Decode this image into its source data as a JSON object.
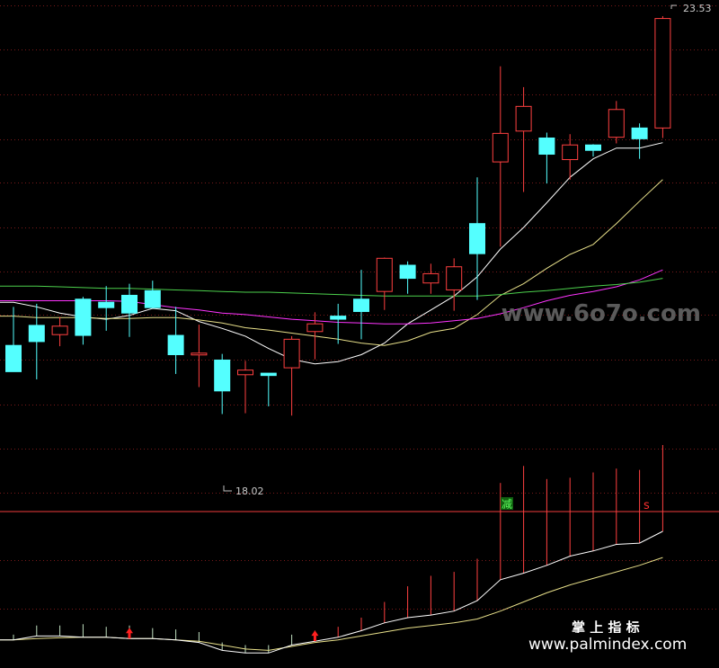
{
  "chart_data": {
    "type": "candlestick",
    "price_labels": {
      "high": "23.53",
      "low": "18.02"
    },
    "price_range": [
      17.7,
      23.6
    ],
    "candles": [
      {
        "o": 19.26,
        "h": 19.76,
        "l": 18.95,
        "c": 18.92
      },
      {
        "o": 19.52,
        "h": 19.8,
        "l": 18.82,
        "c": 19.31
      },
      {
        "o": 19.4,
        "h": 19.63,
        "l": 19.25,
        "c": 19.51
      },
      {
        "o": 19.86,
        "h": 19.89,
        "l": 19.27,
        "c": 19.39
      },
      {
        "o": 19.82,
        "h": 20.03,
        "l": 19.45,
        "c": 19.75
      },
      {
        "o": 19.91,
        "h": 20.06,
        "l": 19.37,
        "c": 19.68
      },
      {
        "o": 19.97,
        "h": 20.1,
        "l": 19.79,
        "c": 19.75
      },
      {
        "o": 19.39,
        "h": 19.76,
        "l": 18.89,
        "c": 19.14
      },
      {
        "o": 19.15,
        "h": 19.53,
        "l": 18.72,
        "c": 19.16
      },
      {
        "o": 19.07,
        "h": 19.15,
        "l": 18.37,
        "c": 18.67
      },
      {
        "o": 18.88,
        "h": 19.06,
        "l": 18.38,
        "c": 18.94
      },
      {
        "o": 18.9,
        "h": 18.9,
        "l": 18.47,
        "c": 18.87
      },
      {
        "o": 18.97,
        "h": 19.38,
        "l": 18.35,
        "c": 19.34
      },
      {
        "o": 19.44,
        "h": 19.69,
        "l": 19.08,
        "c": 19.54
      },
      {
        "o": 19.64,
        "h": 19.8,
        "l": 19.28,
        "c": 19.6
      },
      {
        "o": 19.86,
        "h": 20.24,
        "l": 19.34,
        "c": 19.7
      },
      {
        "o": 19.96,
        "h": 20.4,
        "l": 19.72,
        "c": 20.39
      },
      {
        "o": 20.3,
        "h": 20.35,
        "l": 19.93,
        "c": 20.13
      },
      {
        "o": 20.07,
        "h": 20.32,
        "l": 19.93,
        "c": 20.19
      },
      {
        "o": 19.98,
        "h": 20.39,
        "l": 19.71,
        "c": 20.28
      },
      {
        "o": 20.84,
        "h": 21.44,
        "l": 19.85,
        "c": 20.45
      },
      {
        "o": 21.64,
        "h": 22.88,
        "l": 20.54,
        "c": 22.01
      },
      {
        "o": 22.04,
        "h": 22.61,
        "l": 21.25,
        "c": 22.36
      },
      {
        "o": 21.95,
        "h": 22.02,
        "l": 21.36,
        "c": 21.74
      },
      {
        "o": 21.67,
        "h": 22.0,
        "l": 21.41,
        "c": 21.86
      },
      {
        "o": 21.86,
        "h": 21.87,
        "l": 21.71,
        "c": 21.79
      },
      {
        "o": 21.96,
        "h": 22.43,
        "l": 21.88,
        "c": 22.32
      },
      {
        "o": 22.08,
        "h": 22.14,
        "l": 21.68,
        "c": 21.94
      },
      {
        "o": 22.08,
        "h": 23.53,
        "l": 21.95,
        "c": 23.5
      }
    ],
    "ma_lines": [
      {
        "color": "#ffffff",
        "values": [
          19.82,
          19.76,
          19.68,
          19.63,
          19.6,
          19.65,
          19.74,
          19.71,
          19.57,
          19.48,
          19.38,
          19.22,
          19.08,
          19.02,
          19.05,
          19.14,
          19.29,
          19.54,
          19.72,
          19.9,
          20.15,
          20.51,
          20.79,
          21.11,
          21.44,
          21.68,
          21.82,
          21.82,
          21.89
        ]
      },
      {
        "color": "#e8e08a",
        "values": [
          19.64,
          19.62,
          19.62,
          19.62,
          19.61,
          19.61,
          19.62,
          19.62,
          19.59,
          19.55,
          19.49,
          19.46,
          19.42,
          19.38,
          19.34,
          19.29,
          19.26,
          19.32,
          19.43,
          19.48,
          19.66,
          19.91,
          20.06,
          20.26,
          20.44,
          20.57,
          20.84,
          21.13,
          21.41
        ]
      },
      {
        "color": "#ff34ff",
        "values": [
          19.84,
          19.84,
          19.84,
          19.84,
          19.84,
          19.83,
          19.79,
          19.75,
          19.72,
          19.68,
          19.66,
          19.63,
          19.6,
          19.58,
          19.56,
          19.55,
          19.54,
          19.54,
          19.55,
          19.58,
          19.61,
          19.67,
          19.75,
          19.84,
          19.91,
          19.96,
          20.02,
          20.11,
          20.24
        ]
      },
      {
        "color": "#4cd04c",
        "values": [
          20.03,
          20.03,
          20.02,
          20.01,
          20.0,
          20.0,
          19.99,
          19.98,
          19.97,
          19.96,
          19.95,
          19.95,
          19.94,
          19.93,
          19.92,
          19.91,
          19.9,
          19.9,
          19.9,
          19.9,
          19.9,
          19.92,
          19.95,
          19.97,
          20.0,
          20.03,
          20.05,
          20.08,
          20.13
        ]
      }
    ],
    "indicator": {
      "bars": [
        0.2,
        0.4,
        0.4,
        0.5,
        0.4,
        0.5,
        0.4,
        0.4,
        0.4,
        0.3,
        0.3,
        0.3,
        0.4,
        0.4,
        0.4,
        0.5,
        0.8,
        1.2,
        1.5,
        1.5,
        1.6,
        3.7,
        4.1,
        3.3,
        3.0,
        3.0,
        2.9,
        2.8,
        3.3
      ],
      "line_white": [
        0.2,
        0.35,
        0.35,
        0.3,
        0.3,
        0.25,
        0.25,
        0.2,
        0.1,
        -0.2,
        -0.3,
        -0.3,
        0.0,
        0.15,
        0.3,
        0.55,
        0.85,
        1.05,
        1.15,
        1.3,
        1.7,
        2.5,
        2.75,
        3.05,
        3.4,
        3.6,
        3.85,
        3.9,
        4.35
      ],
      "line_yellow": [
        0.2,
        0.25,
        0.28,
        0.3,
        0.3,
        0.25,
        0.25,
        0.2,
        0.15,
        0.0,
        -0.15,
        -0.2,
        -0.05,
        0.1,
        0.2,
        0.35,
        0.5,
        0.65,
        0.75,
        0.85,
        1.0,
        1.3,
        1.65,
        2.0,
        2.3,
        2.55,
        2.8,
        3.05,
        3.35
      ],
      "range": [
        -0.6,
        4.9
      ],
      "buy_arrows_at": [
        5,
        13
      ],
      "signal_jian": {
        "label": "减",
        "at": 21
      },
      "signal_s": {
        "label": "s",
        "at": 27
      }
    }
  },
  "watermark": "www.6o7o.com",
  "footer": {
    "brand": "掌 上 指 标",
    "url": "www.palmindex.com"
  }
}
